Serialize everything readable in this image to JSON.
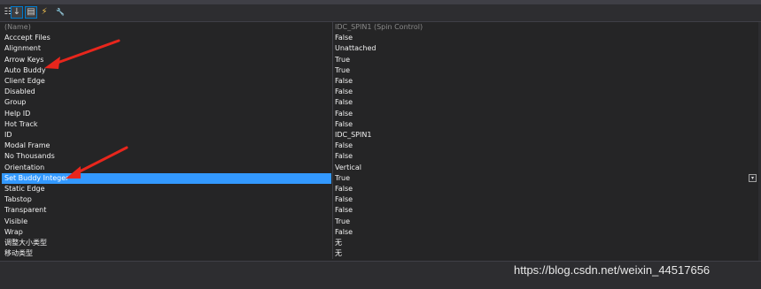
{
  "window": {
    "title": "..."
  },
  "toolbar": {
    "buttons": [
      {
        "name": "categorized-icon",
        "glyph": "☷"
      },
      {
        "name": "alphabetical-icon",
        "glyph": "↓"
      },
      {
        "name": "properties-icon",
        "glyph": "▤"
      },
      {
        "name": "events-icon",
        "glyph": "⚡"
      },
      {
        "name": "property-pages-icon",
        "glyph": "🔧"
      }
    ]
  },
  "grid": {
    "header": {
      "name": "(Name)",
      "value": "IDC_SPIN1 (Spin Control)"
    },
    "rows": [
      {
        "name": "Acccept Files",
        "value": "False"
      },
      {
        "name": "Alignment",
        "value": "Unattached"
      },
      {
        "name": "Arrow Keys",
        "value": "True"
      },
      {
        "name": "Auto Buddy",
        "value": "True"
      },
      {
        "name": "Client Edge",
        "value": "False"
      },
      {
        "name": "Disabled",
        "value": "False"
      },
      {
        "name": "Group",
        "value": "False"
      },
      {
        "name": "Help ID",
        "value": "False"
      },
      {
        "name": "Hot Track",
        "value": "False"
      },
      {
        "name": "ID",
        "value": "IDC_SPIN1"
      },
      {
        "name": "Modal Frame",
        "value": "False"
      },
      {
        "name": "No Thousands",
        "value": "False"
      },
      {
        "name": "Orientation",
        "value": "Vertical"
      },
      {
        "name": "Set Buddy Integer",
        "value": "True"
      },
      {
        "name": "Static Edge",
        "value": "False"
      },
      {
        "name": "Tabstop",
        "value": "False"
      },
      {
        "name": "Transparent",
        "value": "False"
      },
      {
        "name": "Visible",
        "value": "True"
      },
      {
        "name": "Wrap",
        "value": "False"
      },
      {
        "name": "调整大小类型",
        "value": "无"
      },
      {
        "name": "移动类型",
        "value": "无"
      }
    ],
    "selected_index": 13
  },
  "watermark": "https://blog.csdn.net/weixin_44517656",
  "colors": {
    "selection": "#3399ff",
    "annotation_arrow": "#e8261c"
  }
}
